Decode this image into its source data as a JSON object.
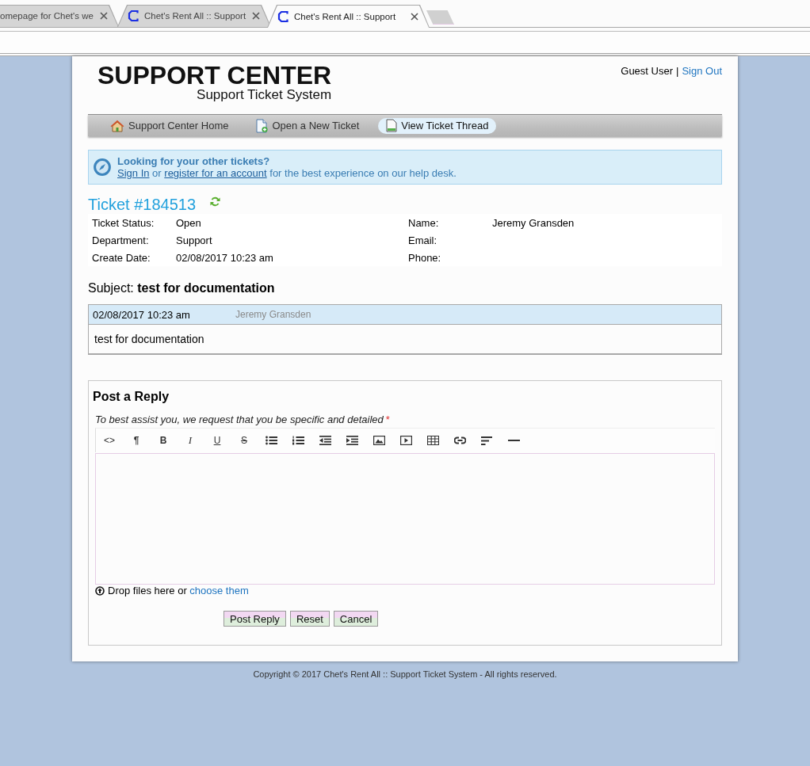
{
  "browser": {
    "tabs": [
      {
        "title": "omepage for Chet's we",
        "favicon": false,
        "selected": false
      },
      {
        "title": "Chet's Rent All :: Support",
        "favicon": true,
        "selected": false
      },
      {
        "title": "Chet's Rent All :: Support",
        "favicon": true,
        "selected": true
      }
    ]
  },
  "header": {
    "logo_title": "SUPPORT CENTER",
    "logo_subtitle": "Support Ticket System",
    "user": "Guest User",
    "separator": "|",
    "sign_out": "Sign Out"
  },
  "nav": [
    {
      "label": "Support Center Home",
      "kind": "home",
      "selected": false
    },
    {
      "label": "Open a New Ticket",
      "kind": "new",
      "selected": false
    },
    {
      "label": "View Ticket Thread",
      "kind": "view",
      "selected": true
    }
  ],
  "notice": {
    "title": "Looking for your other tickets?",
    "parts": [
      {
        "text": "Sign In",
        "link": true
      },
      {
        "text": "or",
        "link": false
      },
      {
        "text": "register for an account",
        "link": true
      },
      {
        "text": "for the best experience on our help desk.",
        "link": false
      }
    ]
  },
  "ticket": {
    "title": "Ticket #184513",
    "columns": [
      {
        "rows": [
          {
            "label": "Ticket Status:",
            "value": "Open"
          },
          {
            "label": "Department:",
            "value": "Support"
          },
          {
            "label": "Create Date:",
            "value": "02/08/2017 10:23 am"
          }
        ]
      },
      {
        "rows": [
          {
            "label": "Name:",
            "value": "Jeremy Gransden"
          },
          {
            "label": "Email:"
          },
          {
            "label": "Phone:"
          }
        ]
      }
    ]
  },
  "subject": "Subject: **test for documentation**",
  "thread": [
    {
      "date": "02/08/2017 10:23 am",
      "author": "Jeremy Gransden",
      "body": "test for documentation"
    }
  ],
  "reply": {
    "title": "Post a Reply",
    "instructions": "To best assist you, we request that you be specific and detailed",
    "required_mark": "*",
    "toolbar": [
      {
        "kind": "code",
        "label": "<>"
      },
      {
        "kind": "paragraph",
        "label": "¶"
      },
      {
        "kind": "bold",
        "label": "B"
      },
      {
        "kind": "italic",
        "label": "I"
      },
      {
        "kind": "underline",
        "label": "U"
      },
      {
        "kind": "strike",
        "label": "S"
      },
      {
        "kind": "bullets"
      },
      {
        "kind": "numbers"
      },
      {
        "kind": "outdent"
      },
      {
        "kind": "indent"
      },
      {
        "kind": "image"
      },
      {
        "kind": "video"
      },
      {
        "kind": "table"
      },
      {
        "kind": "link"
      },
      {
        "kind": "align"
      },
      {
        "kind": "rule"
      }
    ],
    "drop_text": "Drop files here or",
    "choose_link": "choose them",
    "buttons": [
      "Post Reply",
      "Reset",
      "Cancel"
    ]
  },
  "footer": "Copyright © 2017 Chet's Rent All :: Support Ticket System - All rights reserved."
}
